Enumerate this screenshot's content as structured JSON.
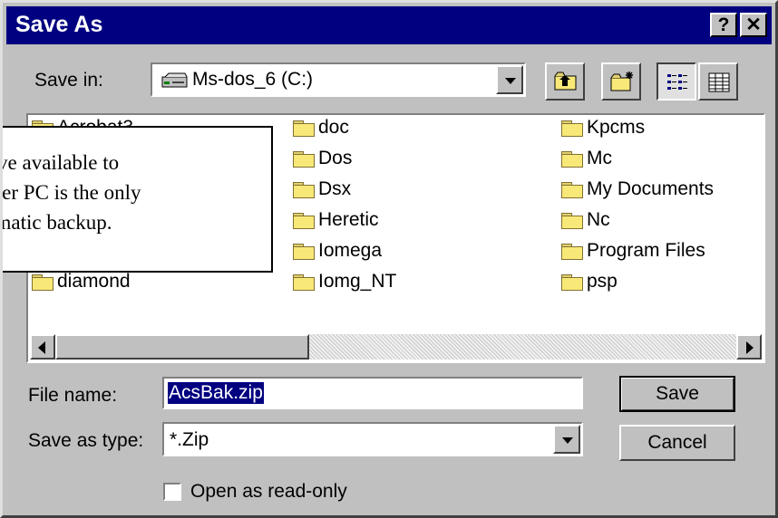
{
  "window": {
    "title": "Save As",
    "help_glyph": "?",
    "close_glyph": "✕"
  },
  "save_in": {
    "label": "Save in:",
    "value": "Ms-dos_6 (C:)"
  },
  "toolbar": {
    "up_icon": "up-one-level-icon",
    "new_folder_icon": "new-folder-icon",
    "list_icon": "list-view-icon",
    "details_icon": "details-view-icon"
  },
  "files": {
    "col1": [
      "Acrobat3",
      "",
      "",
      "",
      "",
      "diamond"
    ],
    "col2": [
      "doc",
      "Dos",
      "Dsx",
      "Heretic",
      "Iomega",
      "Iomg_NT"
    ],
    "col3": [
      "Kpcms",
      "Mc",
      "My Documents",
      "Nc",
      "Program Files",
      "psp"
    ]
  },
  "callout": {
    "lines": [
      "rive available to",
      "rver PC is the only",
      "omatic backup."
    ]
  },
  "file_name": {
    "label": "File name:",
    "value": "AcsBak.zip"
  },
  "save_as_type": {
    "label": "Save as type:",
    "value": "*.Zip"
  },
  "buttons": {
    "save": "Save",
    "cancel": "Cancel"
  },
  "read_only": {
    "label": "Open as read-only",
    "checked": false
  },
  "colors": {
    "titlebar": "#000080",
    "face": "#c0c0c0",
    "selection": "#000080"
  }
}
